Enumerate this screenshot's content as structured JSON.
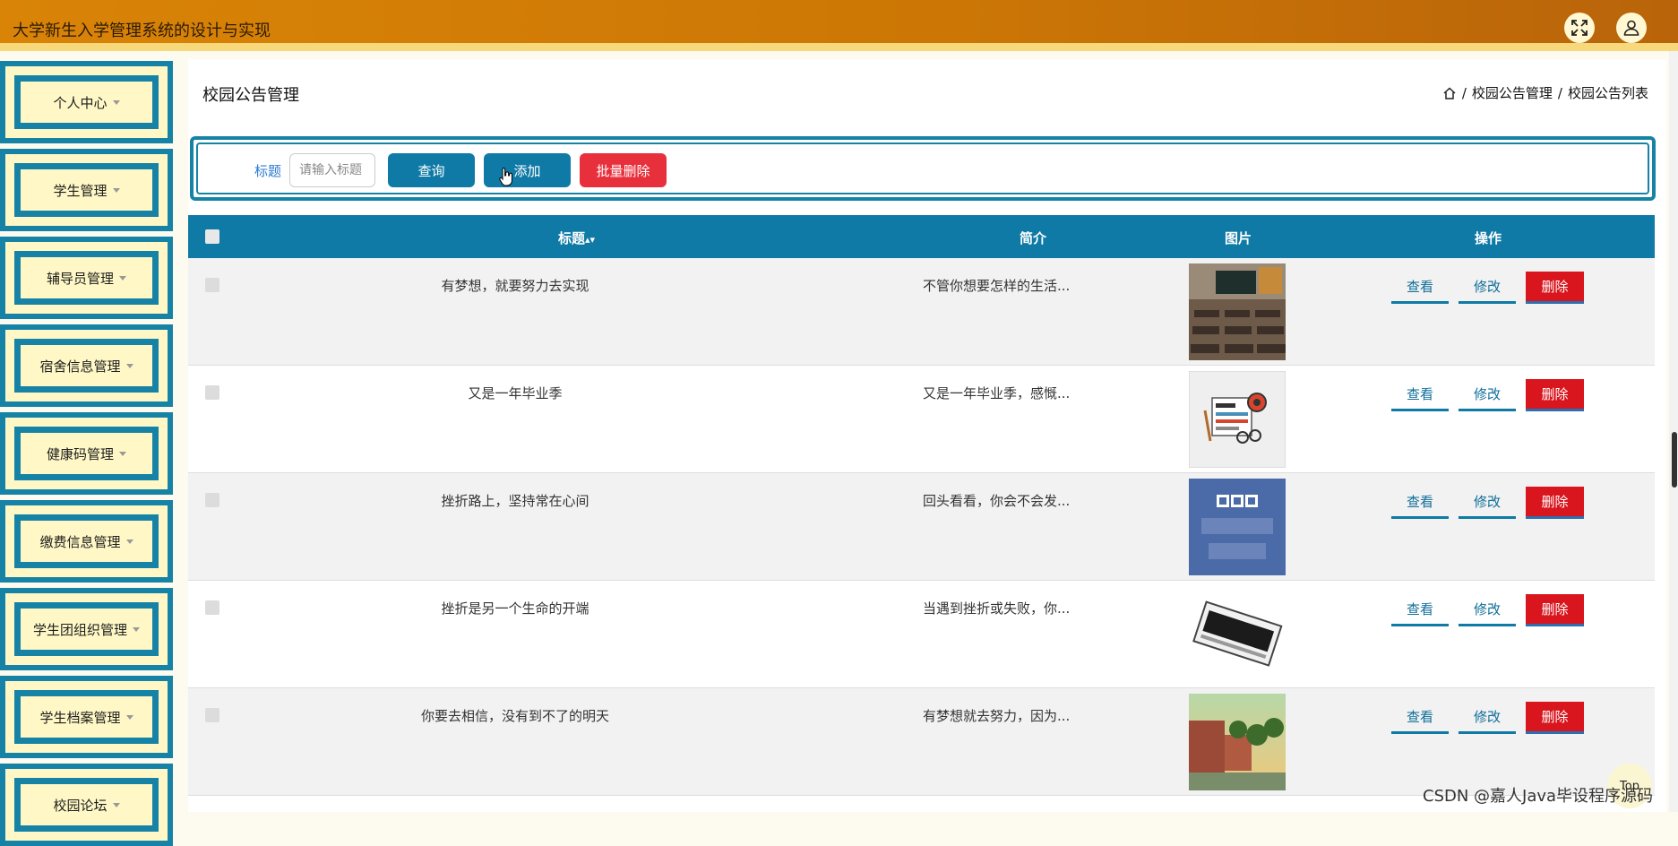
{
  "header": {
    "title": "大学新生入学管理系统的设计与实现",
    "icons": [
      "fullscreen-icon",
      "user-icon"
    ]
  },
  "sidebar": {
    "items": [
      {
        "label": "个人中心"
      },
      {
        "label": "学生管理"
      },
      {
        "label": "辅导员管理"
      },
      {
        "label": "宿舍信息管理"
      },
      {
        "label": "健康码管理"
      },
      {
        "label": "缴费信息管理"
      },
      {
        "label": "学生团组织管理"
      },
      {
        "label": "学生档案管理"
      },
      {
        "label": "校园论坛"
      }
    ]
  },
  "page": {
    "title": "校园公告管理",
    "breadcrumb": [
      "校园公告管理",
      "校园公告列表"
    ]
  },
  "search": {
    "label": "标题",
    "placeholder": "请输入标题",
    "query_label": "查询",
    "add_label": "添加",
    "bulk_delete_label": "批量删除"
  },
  "table": {
    "headers": {
      "title": "标题",
      "intro": "简介",
      "image": "图片",
      "actions": "操作"
    },
    "actions": {
      "view": "查看",
      "edit": "修改",
      "delete": "删除"
    },
    "rows": [
      {
        "title": "有梦想，就要努力去实现",
        "intro": "不管你想要怎样的生活...",
        "image": "classroom"
      },
      {
        "title": "又是一年毕业季",
        "intro": "又是一年毕业季，感慨...",
        "image": "news-paper-illustration"
      },
      {
        "title": "挫折路上，坚持常在心间",
        "intro": "回头看看，你会不会发...",
        "image": "bbc-world-news"
      },
      {
        "title": "挫折是另一个生命的开端",
        "intro": "当遇到挫折或失败，你...",
        "image": "news-logo"
      },
      {
        "title": "你要去相信，没有到不了的明天",
        "intro": "有梦想就去努力，因为...",
        "image": "campus-building"
      }
    ]
  },
  "misc": {
    "top_button": "Top",
    "watermark": "CSDN @嘉人Java毕设程序源码"
  },
  "colors": {
    "header": "#cc7705",
    "accent": "#0f7aa5",
    "danger": "#d9161e",
    "sidebar_bg": "#fff8c6"
  }
}
